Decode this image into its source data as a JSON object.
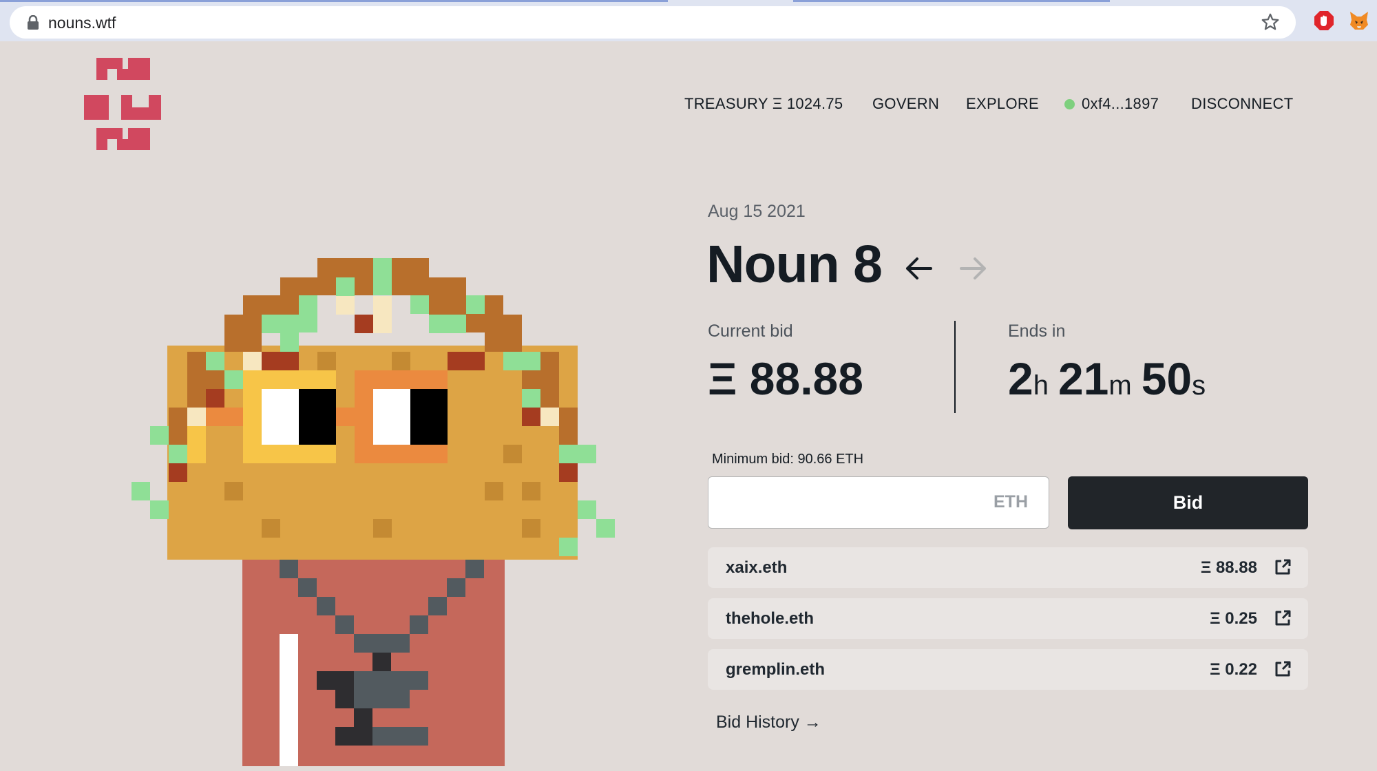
{
  "browser": {
    "url": "nouns.wtf"
  },
  "nav": {
    "treasury": "TREASURY Ξ 1024.75",
    "govern": "GOVERN",
    "explore": "EXPLORE",
    "wallet": "0xf4...1897",
    "disconnect": "DISCONNECT"
  },
  "auction": {
    "date": "Aug 15 2021",
    "title": "Noun 8",
    "current_bid_label": "Current bid",
    "current_bid_value": "Ξ 88.88",
    "ends_in_label": "Ends in",
    "ends_h": "2",
    "ends_h_unit": "h",
    "ends_m": "21",
    "ends_m_unit": "m",
    "ends_s": "50",
    "ends_s_unit": "s",
    "minimum_bid": "Minimum bid: 90.66 ETH",
    "input_unit": "ETH",
    "bid_button": "Bid",
    "bid_history_link": "Bid History →"
  },
  "bids": [
    {
      "bidder": "xaix.eth",
      "amount": "Ξ 88.88"
    },
    {
      "bidder": "thehole.eth",
      "amount": "Ξ 0.25"
    },
    {
      "bidder": "gremplin.eth",
      "amount": "Ξ 0.22"
    }
  ],
  "colors": {
    "background": "#e1dbd8",
    "brand_red": "#d1485f",
    "button_dark": "#212529",
    "wallet_dot": "#7ed07e"
  },
  "icons": [
    "lock-icon",
    "star-icon",
    "adblock-icon",
    "metamask-icon",
    "nouns-logo",
    "arrow-left-icon",
    "arrow-right-icon",
    "external-link-icon"
  ]
}
